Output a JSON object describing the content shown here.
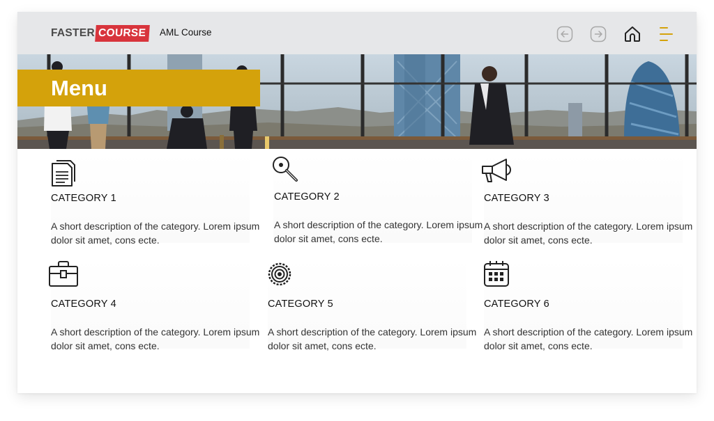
{
  "header": {
    "logo_part1": "FASTER",
    "logo_part2": "COURSE",
    "course_title": "AML Course",
    "accent_color": "#d4a20b",
    "logo_red": "#d8343c",
    "nav": {
      "back_icon": "circle-arrow-left-icon",
      "forward_icon": "circle-arrow-right-icon",
      "home_icon": "home-icon",
      "menu_icon": "hamburger-menu-icon"
    }
  },
  "hero": {
    "title": "Menu"
  },
  "categories": [
    {
      "title": "CATEGORY 1",
      "description": "A short description of the category. Lorem ipsum dolor sit amet, cons ecte.",
      "icon": "documents-icon"
    },
    {
      "title": "CATEGORY 2",
      "description": "A short description of the category. Lorem ipsum dolor sit amet, cons ecte.",
      "icon": "magnifier-icon"
    },
    {
      "title": "CATEGORY 3",
      "description": "A short description of the category. Lorem ipsum dolor sit amet, cons ecte.",
      "icon": "megaphone-icon"
    },
    {
      "title": "CATEGORY 4",
      "description": "A short description of the category. Lorem ipsum dolor sit amet, cons ecte.",
      "icon": "briefcase-icon"
    },
    {
      "title": "CATEGORY 5",
      "description": "A short description of the category. Lorem ipsum dolor sit amet, cons ecte.",
      "icon": "target-gear-icon"
    },
    {
      "title": "CATEGORY 6",
      "description": "A short description of the category. Lorem ipsum dolor sit amet, cons ecte.",
      "icon": "calendar-icon"
    }
  ]
}
